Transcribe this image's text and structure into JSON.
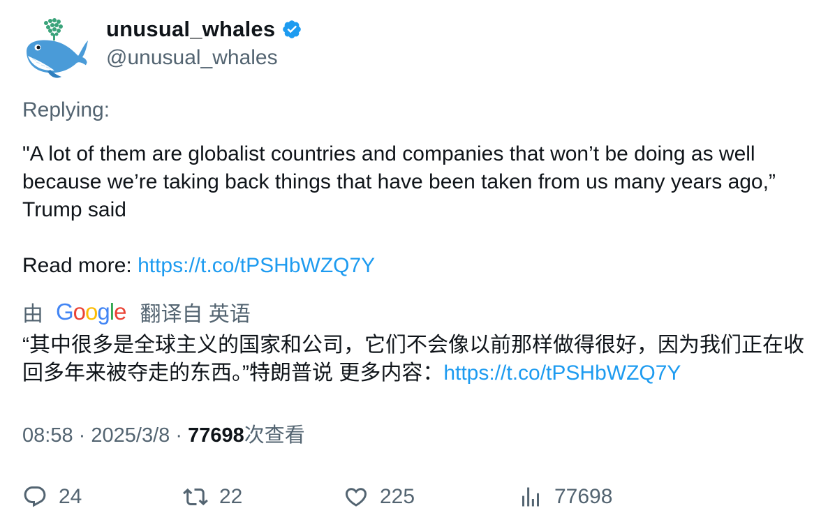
{
  "author": {
    "display_name": "unusual_whales",
    "handle": "@unusual_whales",
    "verified": true
  },
  "tweet": {
    "replying_label": "Replying:",
    "text": "\"A lot of them are globalist countries and companies that won’t be doing as well because we’re taking back things that have been taken from us many years ago,” Trump said",
    "read_more_label": "Read more: ",
    "link": "https://t.co/tPSHbWZQ7Y"
  },
  "translation": {
    "by_label": "由",
    "provider": "Google",
    "from_label": "翻译自 英语",
    "text": "“其中很多是全球主义的国家和公司，它们不会像以前那样做得很好，因为我们正在收回多年来被夺走的东西。”特朗普说 更多内容：",
    "link": "https://t.co/tPSHbWZQ7Y"
  },
  "meta": {
    "time": "08:58",
    "separator": "·",
    "date": "2025/3/8",
    "views": "77698",
    "views_label": "次查看"
  },
  "actions": {
    "replies": "24",
    "reposts": "22",
    "likes": "225",
    "views": "77698"
  },
  "colors": {
    "link": "#1d9bf0",
    "secondary": "#536471",
    "primary": "#0f1419",
    "verified": "#1d9bf0"
  },
  "icons": {
    "avatar": "whale-avatar",
    "verified": "verified-badge-icon",
    "reply": "reply-icon",
    "repost": "repost-icon",
    "like": "heart-icon",
    "views": "analytics-icon"
  }
}
